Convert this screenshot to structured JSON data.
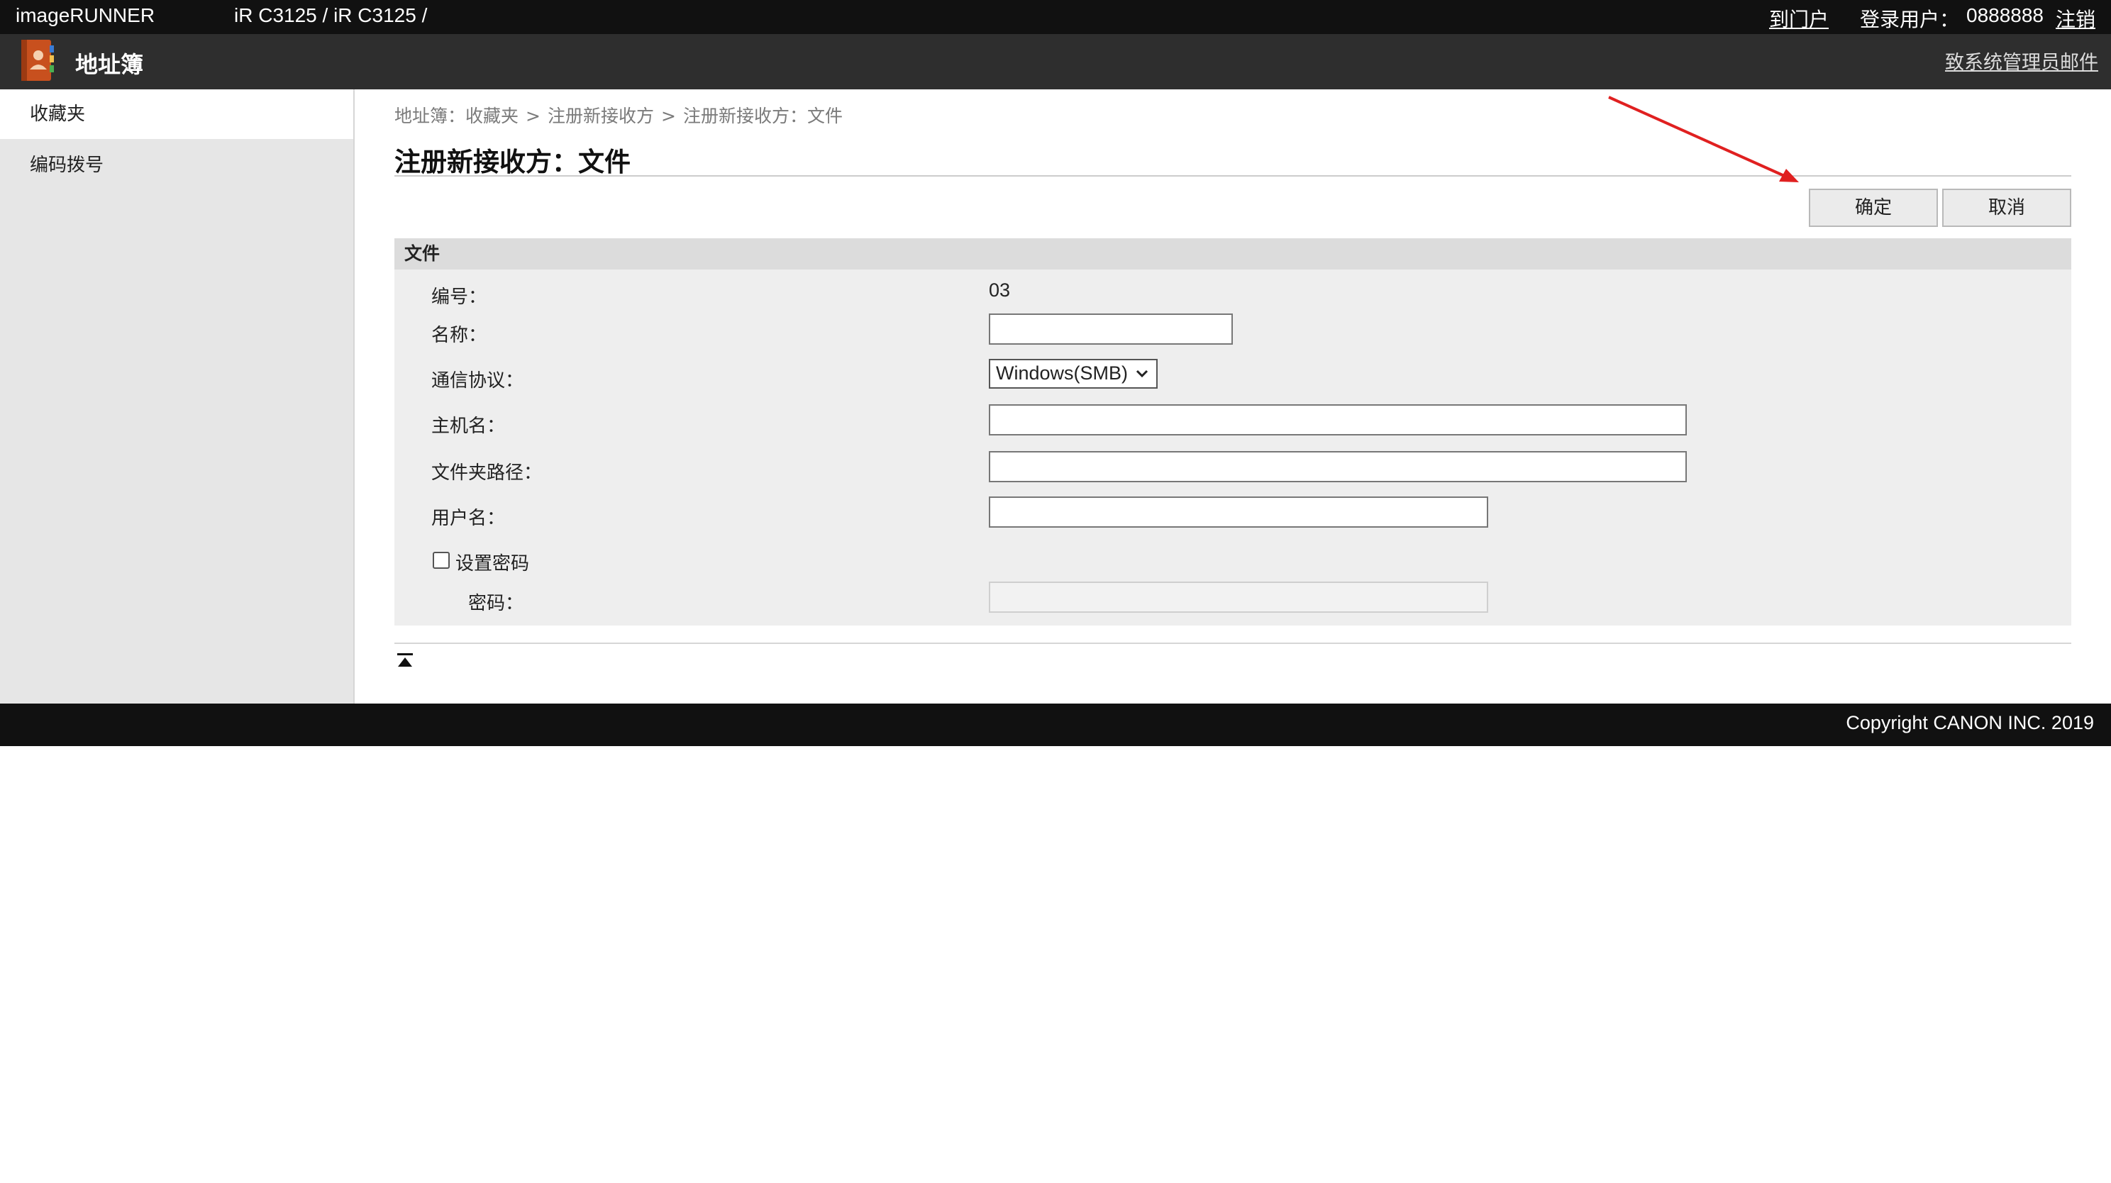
{
  "topbar": {
    "brand": "imageRUNNER",
    "model": "iR C3125 / iR C3125 /",
    "portal_link": "到门户",
    "user_label": "登录用户：",
    "user_id": "0888888",
    "logout_link": "注销"
  },
  "appbar": {
    "title": "地址簿",
    "icon": "address-book-icon",
    "mail_admin_link": "致系统管理员邮件"
  },
  "sidebar": {
    "items": [
      {
        "label": "收藏夹",
        "active": true
      },
      {
        "label": "编码拨号",
        "active": false
      }
    ]
  },
  "breadcrumb": {
    "items": [
      "地址簿：收藏夹",
      "注册新接收方",
      "注册新接收方：文件"
    ],
    "separator": ">"
  },
  "page": {
    "title": "注册新接收方：文件",
    "ok_button": "确定",
    "cancel_button": "取消"
  },
  "form": {
    "section_title": "文件",
    "number_label": "编号：",
    "number_value": "03",
    "name_label": "名称：",
    "name_value": "",
    "protocol_label": "通信协议：",
    "protocol_selected": "Windows(SMB)",
    "host_label": "主机名：",
    "host_value": "",
    "folder_label": "文件夹路径：",
    "folder_value": "",
    "user_label": "用户名：",
    "user_value": "",
    "set_password_label": "设置密码",
    "set_password_checked": false,
    "password_label": "密码：",
    "password_value": ""
  },
  "page_top_icon": "back-to-top-icon",
  "footer": {
    "copyright": "Copyright CANON INC. 2019"
  },
  "colors": {
    "topbar": "#111111",
    "appbar": "#2e2e2e",
    "sidebar": "#e6e6e6",
    "section": "#eeeeee",
    "annotation_arrow": "#e02020"
  }
}
